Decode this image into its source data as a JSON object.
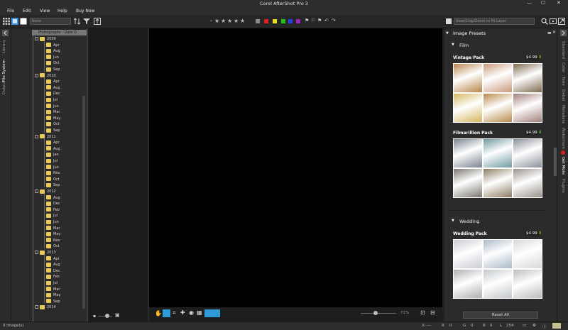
{
  "window": {
    "title": "Corel AfterShot Pro 3",
    "minimize": "—",
    "maximize": "☐",
    "close": "✕"
  },
  "menu": [
    "File",
    "Edit",
    "View",
    "Help",
    "Buy Now"
  ],
  "toolbar": {
    "filter_placeholder": "None",
    "preset_placeholder": "View/Crop/Zoom to Fit Layer",
    "stars": [
      "★",
      "★",
      "★",
      "★",
      "★"
    ],
    "color_labels": [
      "#8a8a8a",
      "#e02020",
      "#e8e020",
      "#20c020",
      "#2040e0",
      "#a020c0"
    ]
  },
  "left_tabs": [
    "Library",
    "File System",
    "Output"
  ],
  "left_tabs_active": "File System",
  "tree": {
    "root": "Photographs - Date O",
    "years": [
      {
        "year": "2009",
        "months": [
          "Apr",
          "Aug",
          "Jun",
          "Oct",
          "Sep"
        ]
      },
      {
        "year": "2010",
        "months": [
          "Apr",
          "Aug",
          "Dec",
          "Jul",
          "Jun",
          "Mar",
          "May",
          "Oct",
          "Sep"
        ]
      },
      {
        "year": "2011",
        "months": [
          "Apr",
          "Aug",
          "Jan",
          "Jul",
          "Jun",
          "Nov",
          "Oct",
          "Sep"
        ]
      },
      {
        "year": "2012",
        "months": [
          "Aug",
          "Dec",
          "Feb",
          "Jul",
          "Jun",
          "Mar",
          "May",
          "Nov",
          "Oct"
        ]
      },
      {
        "year": "2013",
        "months": [
          "Apr",
          "Aug",
          "Dec",
          "Feb",
          "Jul",
          "Mar",
          "May",
          "Sep"
        ]
      },
      {
        "year": "2014",
        "months": []
      }
    ]
  },
  "viewer": {
    "zoom": "71%"
  },
  "right_panel": {
    "title": "Image Presets",
    "sections": [
      {
        "name": "Film",
        "packs": [
          {
            "name": "Vintage Pack",
            "price": "$4.99",
            "swatches": [
              "#b9854a",
              "#c99a7b",
              "#7f6a4e",
              "#d4b65e",
              "#b88a4a",
              "#a0807a"
            ]
          },
          {
            "name": "Filmarillion Pack",
            "price": "$4.99",
            "swatches": [
              "#7a8290",
              "#6e9aa0",
              "#8a8f9a",
              "#7b7770",
              "#8c7d62",
              "#9a928a"
            ]
          }
        ]
      },
      {
        "name": "Wedding",
        "packs": [
          {
            "name": "Wedding Pack",
            "price": "$4.99",
            "swatches": [
              "#c9ccd2",
              "#aab8c8",
              "#d8d8dc",
              "#b0b0b4",
              "#c4c8cc",
              "#bcbcc0"
            ]
          }
        ]
      }
    ],
    "reset_label": "Reset All"
  },
  "right_tabs": [
    "Standard",
    "Color",
    "Tone",
    "Detail",
    "Metadata",
    "Watermark",
    "Get More",
    "Plugins"
  ],
  "status": {
    "images": "0 image(s)",
    "x_label": "X: ---",
    "y_label": "Y: ---",
    "r": "R",
    "g": "G",
    "b": "B",
    "l": "L",
    "values": [
      "0",
      "0",
      "0",
      "254"
    ]
  }
}
